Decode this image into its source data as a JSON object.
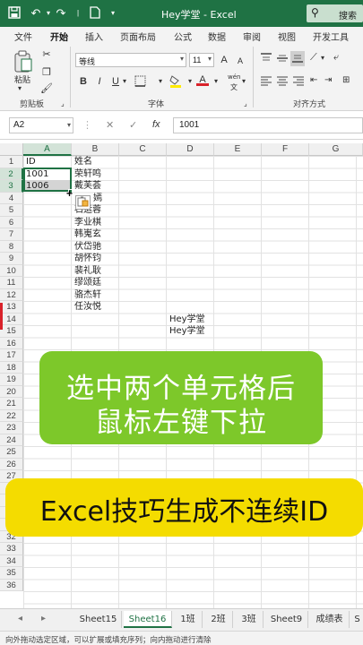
{
  "window": {
    "title": "Hey学堂 - Excel",
    "search_label": "搜索"
  },
  "tabs": [
    "文件",
    "开始",
    "插入",
    "页面布局",
    "公式",
    "数据",
    "审阅",
    "视图",
    "开发工具"
  ],
  "ribbon": {
    "paste_label": "粘贴",
    "clipboard_label": "剪贴板",
    "font_name": "等线",
    "font_size": "11",
    "font_group_label": "字体",
    "align_group_label": "对齐方式",
    "bold": "B",
    "italic": "I",
    "underline": "U",
    "grow": "A",
    "shrink": "A",
    "font_color": "A",
    "wen": "wén"
  },
  "formula_bar": {
    "name_box": "A2",
    "fx": "fx",
    "value": "1001"
  },
  "columns": [
    "A",
    "B",
    "C",
    "D",
    "E",
    "F",
    "G"
  ],
  "rows": [
    "1",
    "2",
    "3",
    "4",
    "5",
    "6",
    "7",
    "8",
    "9",
    "10",
    "11",
    "12",
    "13",
    "14",
    "15",
    "16",
    "17",
    "18",
    "19",
    "20",
    "21",
    "22",
    "23",
    "24",
    "25",
    "26",
    "27",
    "28",
    "29",
    "30",
    "31",
    "32",
    "33",
    "34",
    "35",
    "36"
  ],
  "cells": {
    "A1": "ID",
    "A2": "1001",
    "A3": "1006",
    "B1": "姓名",
    "B2": "荣轩鸣",
    "B3": "戴芙荟",
    "B4": "嫣",
    "B5": "石运蓉",
    "B6": "李业棋",
    "B7": "韩嵬玄",
    "B8": "伏岱驰",
    "B9": "胡怀钧",
    "B10": "裴礼耿",
    "B11": "缪颂廷",
    "B12": "骆杰轩",
    "B13": "任汝悦",
    "D14": "Hey学堂",
    "D15": "Hey学堂"
  },
  "overlay": {
    "line1": "选中两个单元格后",
    "line2": "鼠标左键下拉",
    "banner": "Excel技巧生成不连续ID"
  },
  "sheets": [
    "Sheet15",
    "Sheet16",
    "1班",
    "2班",
    "3班",
    "Sheet9",
    "成绩表",
    "S"
  ],
  "active_sheet": "Sheet16",
  "status": "向外拖动选定区域，可以扩展或填充序列；向内拖动进行清除",
  "colors": {
    "excel_green": "#1f7244",
    "green_overlay": "#7dc82a",
    "yellow_banner": "#f4dc00"
  }
}
